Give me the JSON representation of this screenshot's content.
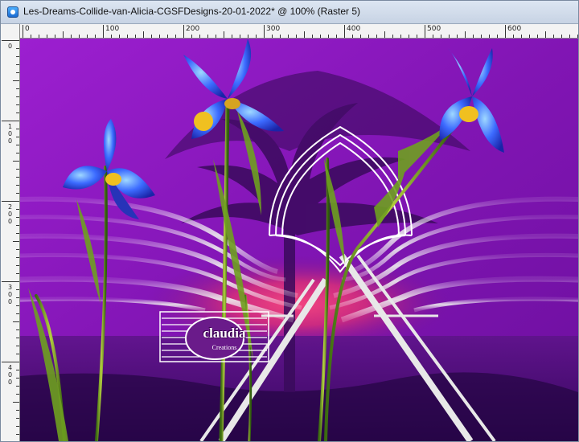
{
  "window": {
    "title": "Les-Dreams-Collide-van-Alicia-CGSFDesigns-20-01-2022* @ 100% (Raster 5)",
    "icon": "paintshop-app-icon"
  },
  "ruler": {
    "horizontal_labels": [
      "0",
      "100",
      "200",
      "300",
      "400",
      "500",
      "600"
    ],
    "vertical_labels": [
      "0",
      "100",
      "200",
      "300",
      "400"
    ]
  },
  "canvas": {
    "watermark_text": "claudia",
    "watermark_subtext": "Creations"
  },
  "colors": {
    "titlebar": "#c7d3e4",
    "ruler": "#f3f3f3",
    "canvas_purple": "#8a18b8",
    "sunset": "#e0306a"
  }
}
